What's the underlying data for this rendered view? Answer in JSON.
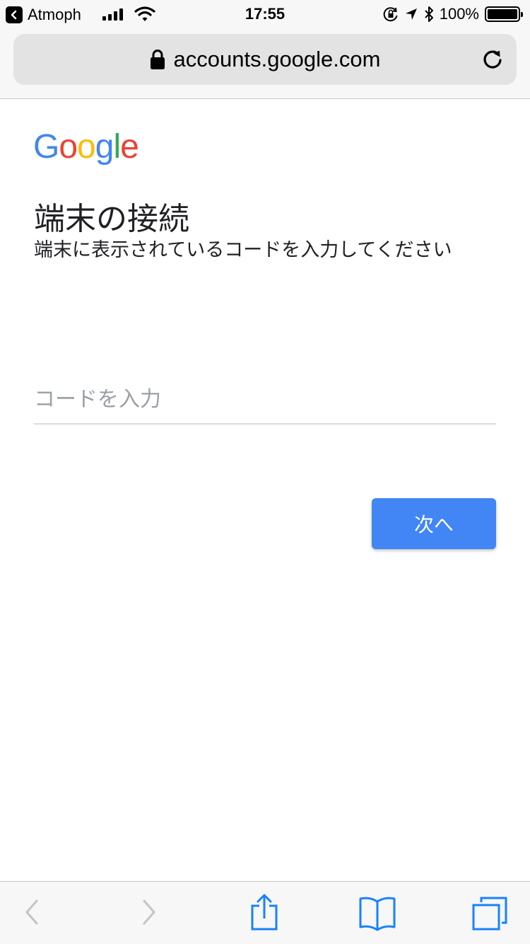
{
  "status_bar": {
    "back_app_label": "Atmoph",
    "time": "17:55",
    "battery_percent": "100%",
    "battery_level": 1.0
  },
  "browser": {
    "url": "accounts.google.com"
  },
  "page": {
    "logo_text": "Google",
    "title": "端末の接続",
    "subtitle": "端末に表示されているコードを入力してください",
    "code_input": {
      "placeholder": "コードを入力",
      "value": ""
    },
    "next_label": "次へ"
  },
  "colors": {
    "accent": "#4285f4",
    "logo": [
      "#4285f4",
      "#ea4335",
      "#fbbc05",
      "#4285f4",
      "#34a853",
      "#ea4335"
    ]
  },
  "toolbar": {
    "icons": [
      "back-icon",
      "forward-icon",
      "share-icon",
      "bookmarks-icon",
      "tabs-icon"
    ]
  }
}
